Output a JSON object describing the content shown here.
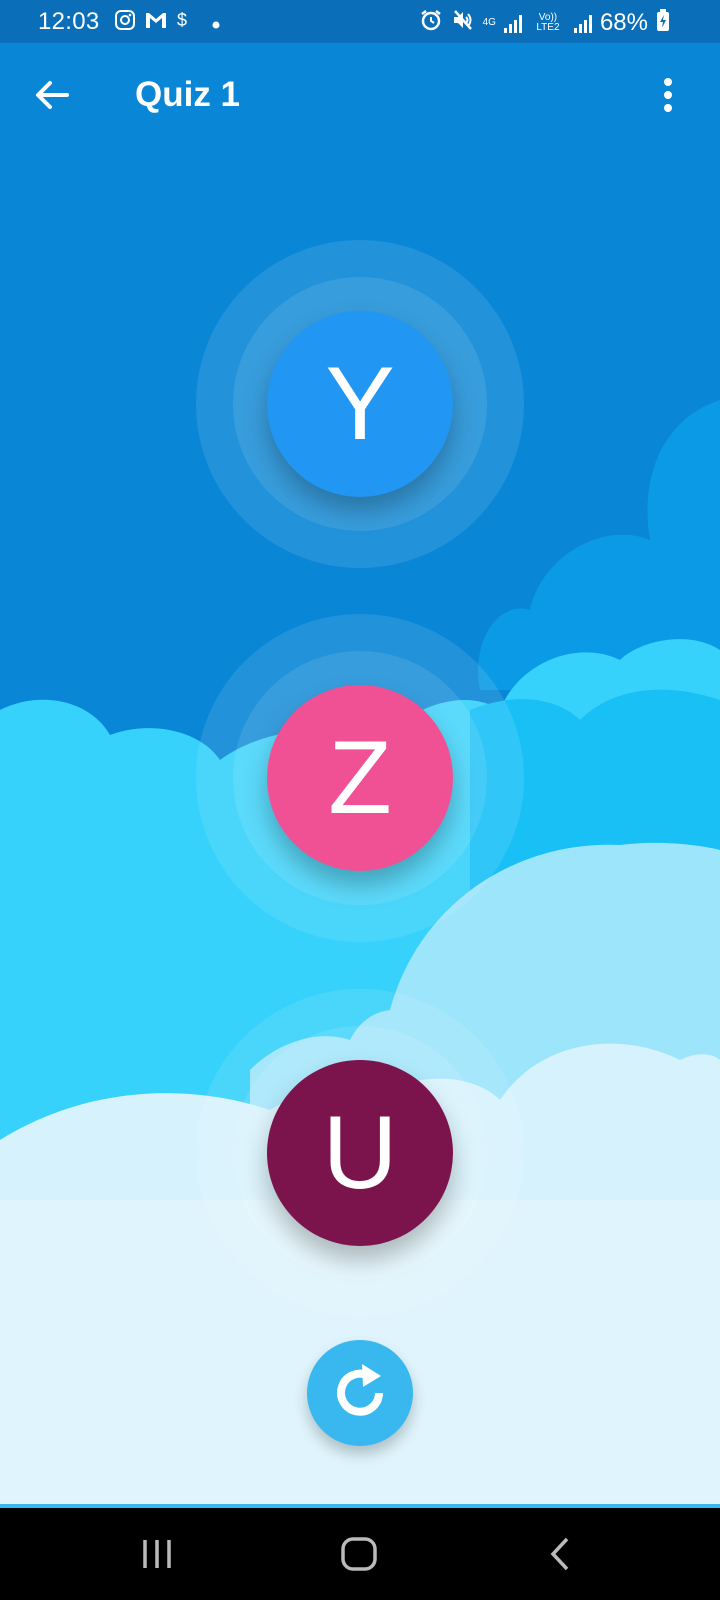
{
  "status_bar": {
    "time": "12:03",
    "left_icons": [
      "instagram-icon",
      "gmail-icon",
      "dollar-icon",
      "dot-icon"
    ],
    "network_4g": "4G",
    "network_volte": "Vo)) LTE2",
    "battery_percent": "68%"
  },
  "app_bar": {
    "title": "Quiz 1"
  },
  "choices": [
    {
      "letter": "Y",
      "color": "#2196f3"
    },
    {
      "letter": "Z",
      "color": "#f05194"
    },
    {
      "letter": "U",
      "color": "#7b144c"
    }
  ],
  "colors": {
    "status_bar": "#0a6fb8",
    "sky": "#0a86d6",
    "refresh": "#39b8f0"
  }
}
